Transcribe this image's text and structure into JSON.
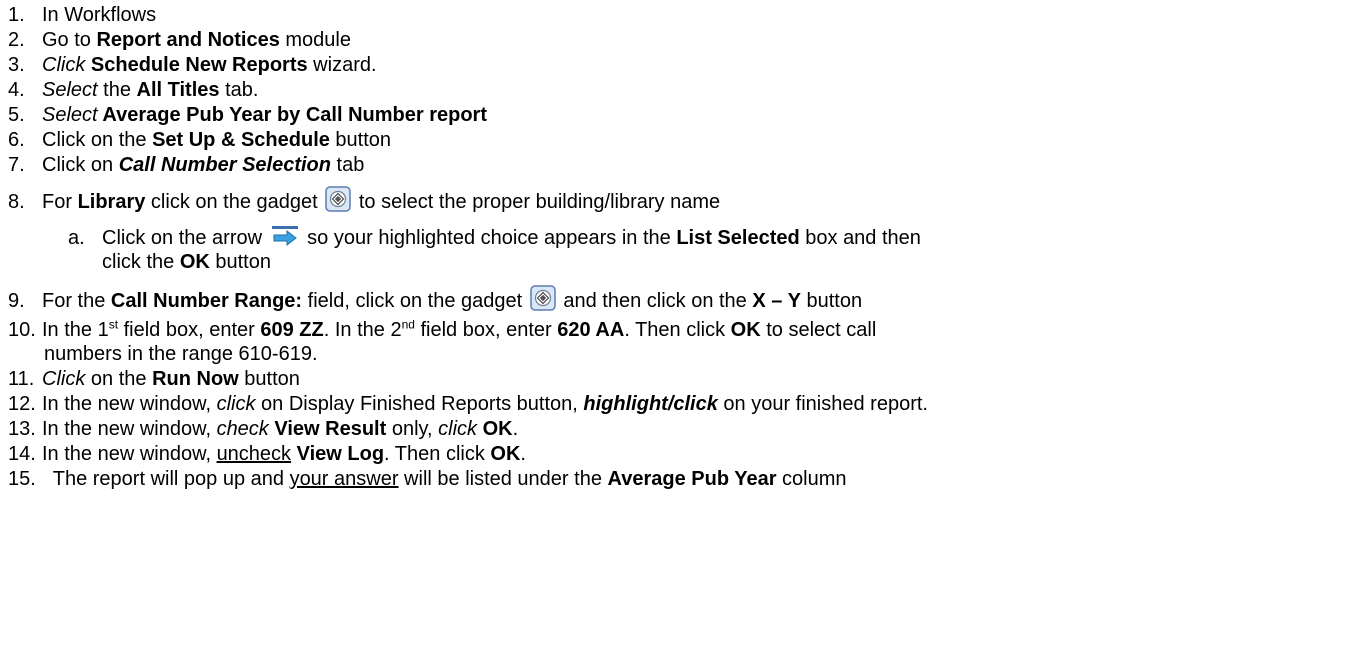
{
  "steps": [
    {
      "num": "1.",
      "t1": "In Workflows"
    },
    {
      "num": "2.",
      "t1": "Go to ",
      "b1": "Report and Notices",
      "t2": " module"
    },
    {
      "num": "3.",
      "i1": "Click",
      "b1": " Schedule New Reports",
      "t2": " wizard."
    },
    {
      "num": "4.",
      "i1": "Select",
      "t1": " the ",
      "b1": "All Titles",
      "t2": " tab."
    },
    {
      "num": "5.",
      "i1": "Select",
      "b1": " Average Pub Year by Call Number report"
    },
    {
      "num": "6.",
      "t1": "Click on the ",
      "b1": "Set Up & Schedule",
      "t2": " button"
    },
    {
      "num": "7.",
      "t1": "Click on ",
      "bi1": "Call Number Selection",
      "t2": " tab"
    },
    {
      "num": "8.",
      "t1": "For ",
      "b1": "Library",
      "t2": " click on the gadget",
      "t3": " to select the proper building/library name"
    },
    {
      "num": "a.",
      "t1": "Click on the arrow",
      "t2": " so your highlighted choice appears in the ",
      "b1": "List Selected",
      "t3": " box and then",
      "cont_t1": "click the ",
      "cont_b1": "OK",
      "cont_t2": " button"
    },
    {
      "num": "9.",
      "t1": "For the ",
      "b1": "Call Number Range:",
      "t2": " field, click on the gadget",
      "t3": " and then click on the ",
      "b2": "X – Y",
      "t4": " button"
    },
    {
      "num": "10.",
      "t1": "In the 1",
      "s1": "st",
      "t2": " field box, enter ",
      "b1": "609 ZZ",
      "t3": ".  In the 2",
      "s2": "nd",
      "t4": " field box, enter ",
      "b2": "620 AA",
      "t5": ". Then click ",
      "b3": "OK",
      "t6": " to select call",
      "cont_t1": "numbers in the range 610-619."
    },
    {
      "num": "11.",
      "i1": "Click",
      "t1": " on the ",
      "b1": "Run Now",
      "t2": " button"
    },
    {
      "num": "12.",
      "t1": "In the new window, ",
      "i1": "click",
      "t2": " on Display Finished Reports button, ",
      "bi1": "highlight/click",
      "t3": " on your finished report."
    },
    {
      "num": "13.",
      "t1": "In the new window, ",
      "i1": "check",
      "b1": " View Result",
      "t2": " only, ",
      "i2": "click",
      "b2": " OK",
      "t3": "."
    },
    {
      "num": "14.",
      "t1": "In the new window, ",
      "u1": "uncheck",
      "b1": " View Log",
      "t2": ".  Then click ",
      "b2": "OK",
      "t3": "."
    },
    {
      "num": "15.",
      "t1": "  The report will pop up and ",
      "u1": "your answer",
      "t2": " will be listed under the ",
      "b1": "Average Pub Year",
      "t3": " column"
    }
  ],
  "icons": {
    "gadget": "gadget-icon",
    "arrow": "right-arrow-icon"
  },
  "colors": {
    "gadget_border": "#5a7fb0",
    "gadget_fill": "#dbe7f6",
    "arrow_fill": "#3aa0e0"
  }
}
